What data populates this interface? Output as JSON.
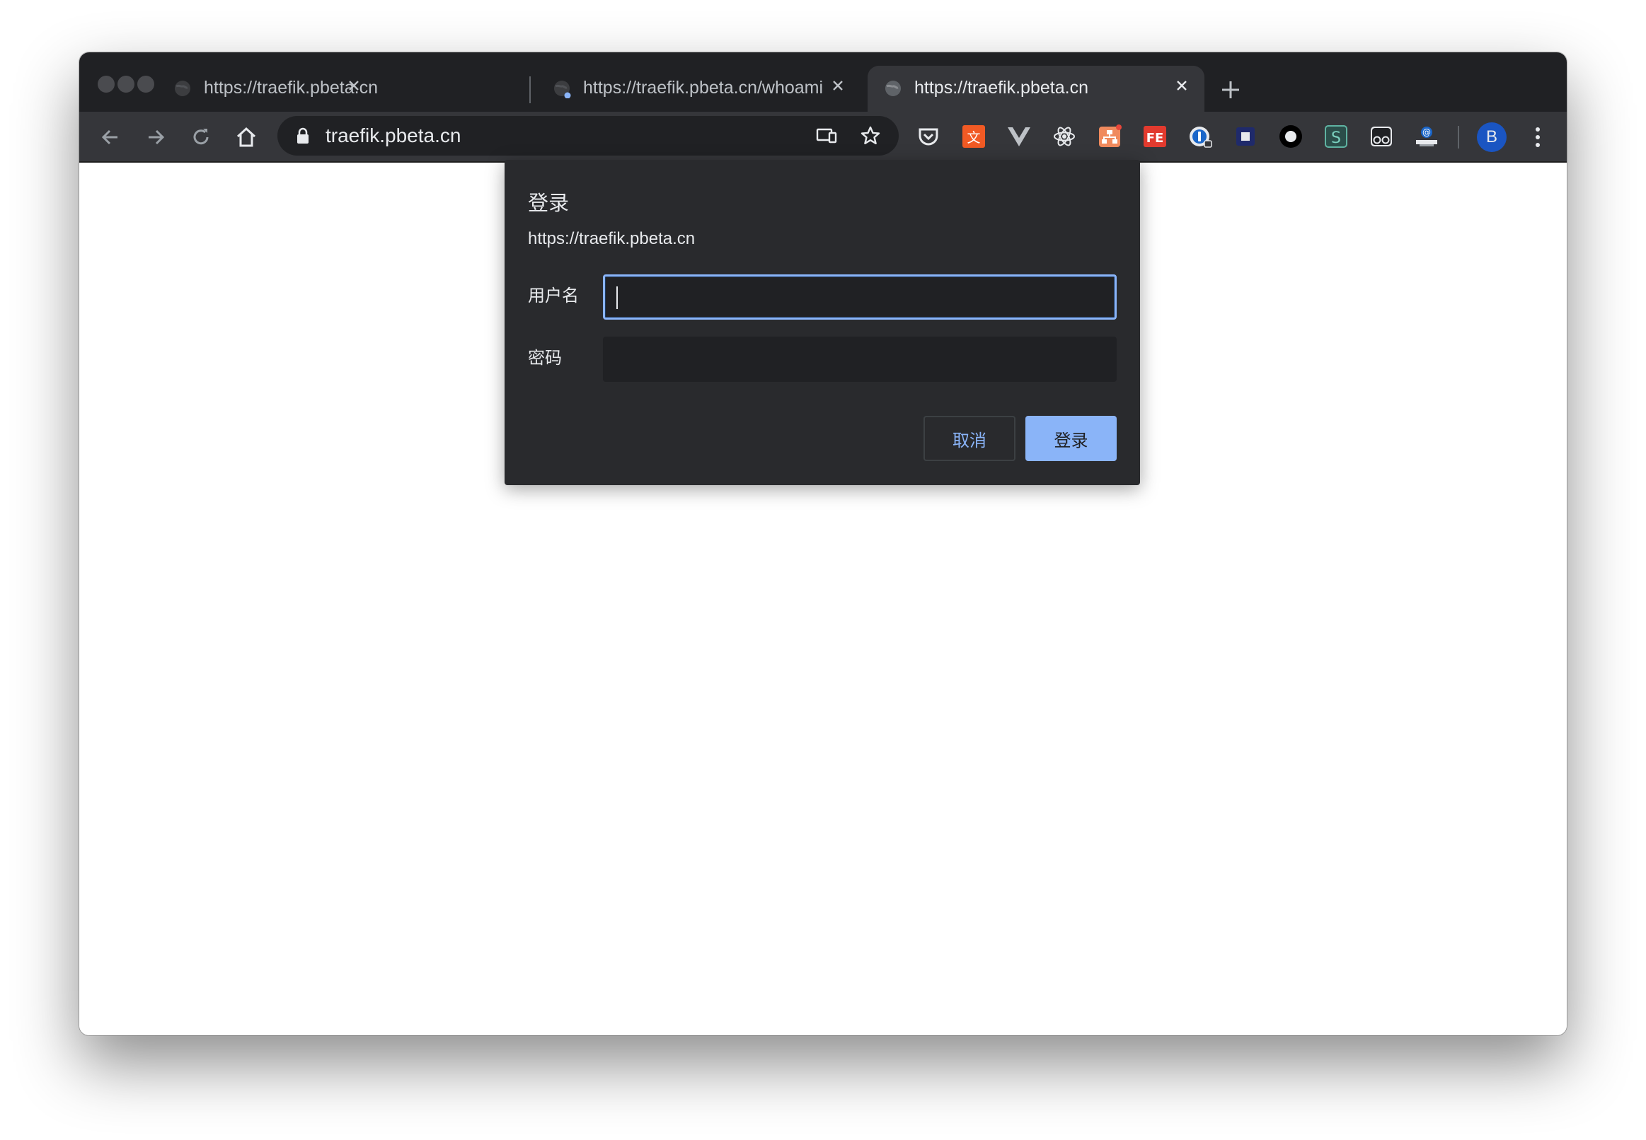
{
  "tabs": [
    {
      "title": "https://traefik.pbeta.cn",
      "active": false
    },
    {
      "title": "https://traefik.pbeta.cn/whoami",
      "active": false
    },
    {
      "title": "https://traefik.pbeta.cn",
      "active": true
    }
  ],
  "address_bar": {
    "url": "traefik.pbeta.cn"
  },
  "profile": {
    "initial": "B"
  },
  "dialog": {
    "title": "登录",
    "origin": "https://traefik.pbeta.cn",
    "username_label": "用户名",
    "username_value": "",
    "password_label": "密码",
    "password_value": "",
    "cancel_label": "取消",
    "login_label": "登录"
  },
  "colors": {
    "frame": "#202124",
    "toolbar": "#35363a",
    "dialog": "#292a2d",
    "accent": "#8ab4f8"
  }
}
